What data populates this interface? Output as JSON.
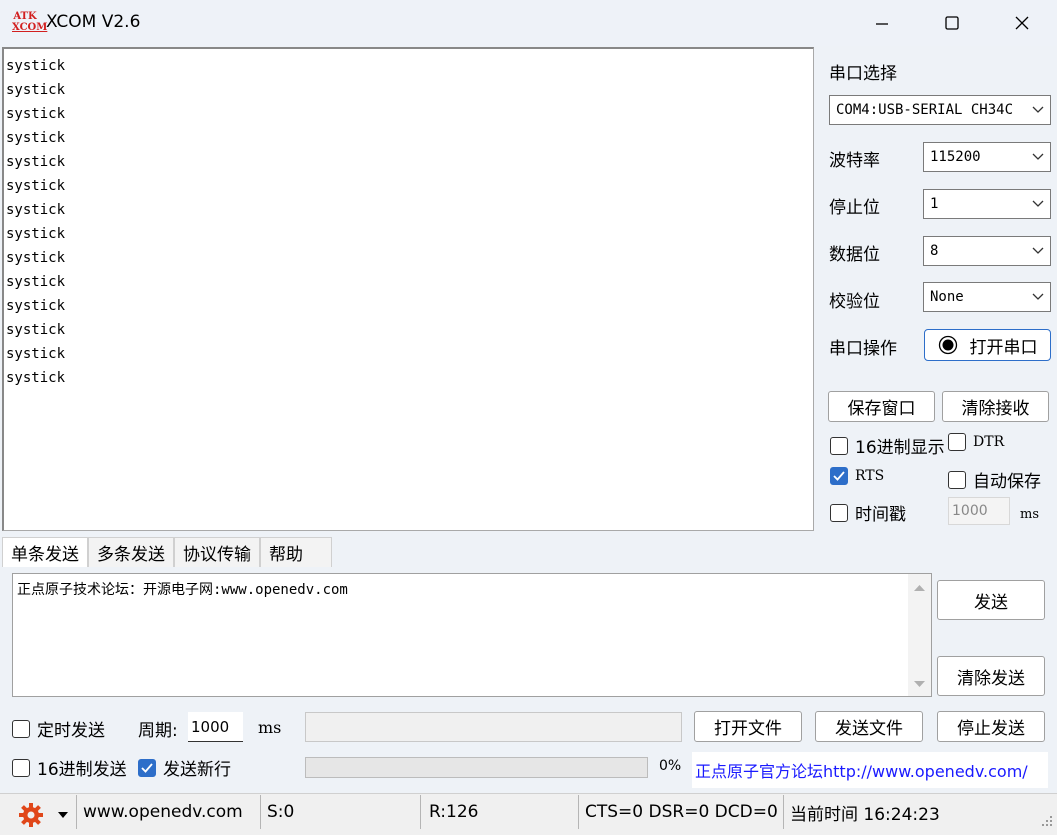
{
  "window": {
    "logo_top": "ATK",
    "logo_bottom": "XCOM",
    "title": "XCOM V2.6",
    "minimize": "—",
    "maximize": "☐",
    "close": "✕"
  },
  "receive": {
    "lines": [
      "systick",
      "systick",
      "systick",
      "systick",
      "systick",
      "systick",
      "systick",
      "systick",
      "systick",
      "systick",
      "systick",
      "systick",
      "systick",
      "systick"
    ]
  },
  "port": {
    "section_label": "串口选择",
    "port_value": "COM4:USB-SERIAL CH34C",
    "baud_label": "波特率",
    "baud_value": "115200",
    "stop_label": "停止位",
    "stop_value": "1",
    "data_label": "数据位",
    "data_value": "8",
    "parity_label": "校验位",
    "parity_value": "None",
    "op_label": "串口操作",
    "open_button": "打开串口",
    "save_window": "保存窗口",
    "clear_recv": "清除接收",
    "hex_display": "16进制显示",
    "dtr": "DTR",
    "rts": "RTS",
    "auto_save": "自动保存",
    "timestamp": "时间戳",
    "timestamp_value": "1000",
    "timestamp_unit": "ms"
  },
  "tabs": [
    {
      "label": "单条发送",
      "active": true
    },
    {
      "label": "多条发送",
      "active": false
    },
    {
      "label": "协议传输",
      "active": false
    },
    {
      "label": "帮助",
      "active": false
    }
  ],
  "send": {
    "text": "正点原子技术论坛：开源电子网:www.openedv.com",
    "send_button": "发送",
    "clear_send": "清除发送",
    "timed_send": "定时发送",
    "period_label": "周期:",
    "period_value": "1000",
    "period_unit": "ms",
    "open_file": "打开文件",
    "send_file": "发送文件",
    "stop_send": "停止发送",
    "hex_send": "16进制发送",
    "send_newline": "发送新行",
    "progress_text": "0%",
    "progress": 0,
    "forum_link": "正点原子官方论坛http://www.openedv.com/"
  },
  "statusbar": {
    "site": "www.openedv.com",
    "sent": "S:0",
    "received": "R:126",
    "signals": "CTS=0 DSR=0 DCD=0",
    "time": "当前时间 16:24:23"
  },
  "colors": {
    "accent": "#2d6ec9",
    "logo": "#d21f1f",
    "link": "#1a1aff",
    "gear": "#e0471a"
  }
}
